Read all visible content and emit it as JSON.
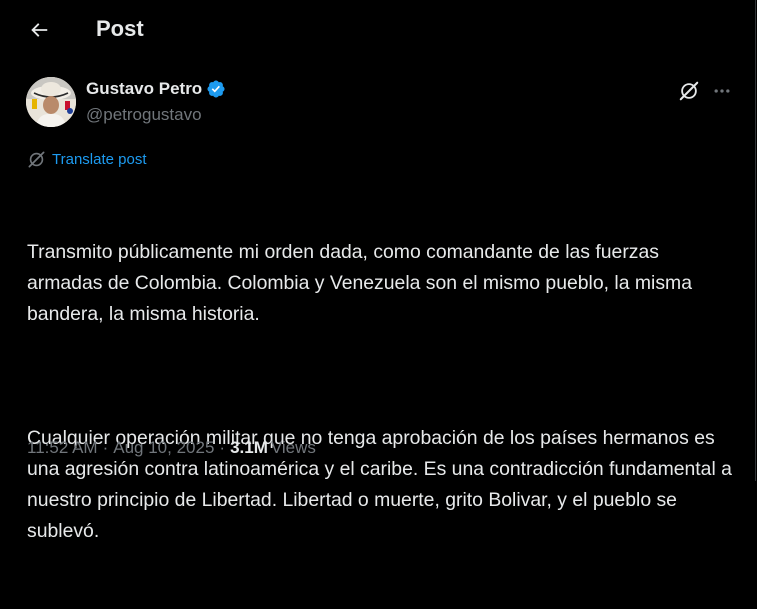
{
  "header": {
    "title": "Post"
  },
  "post": {
    "author": {
      "display_name": "Gustavo Petro",
      "handle": "@petrogustavo",
      "verified": true
    },
    "translate_label": "Translate post",
    "text_paragraphs": [
      "Transmito públicamente mi orden dada, como comandante de las fuerzas armadas de Colombia. Colombia y Venezuela son el mismo pueblo, la misma bandera, la misma historia.",
      "Cualquier operación militar que no tenga aprobación de los países hermanos es una agresión contra latinoamérica y el caribe. Es una contradicción fundamental a nuestro principio de Libertad. Libertad o muerte, grito Bolivar, y el pueblo se sublevó."
    ],
    "time": "11:52 AM",
    "date": "Aug 10, 2025",
    "separator": "·",
    "views_count": "3.1M",
    "views_label": "Views"
  },
  "icons": {
    "back": "arrow-left-icon",
    "verified": "verified-badge-icon",
    "grok": "grok-icon",
    "more": "more-horizontal-icon",
    "translate": "translate-icon"
  },
  "colors": {
    "background": "#000000",
    "primary_text": "#e7e9ea",
    "secondary_text": "#71767b",
    "accent": "#1d9bf0"
  }
}
